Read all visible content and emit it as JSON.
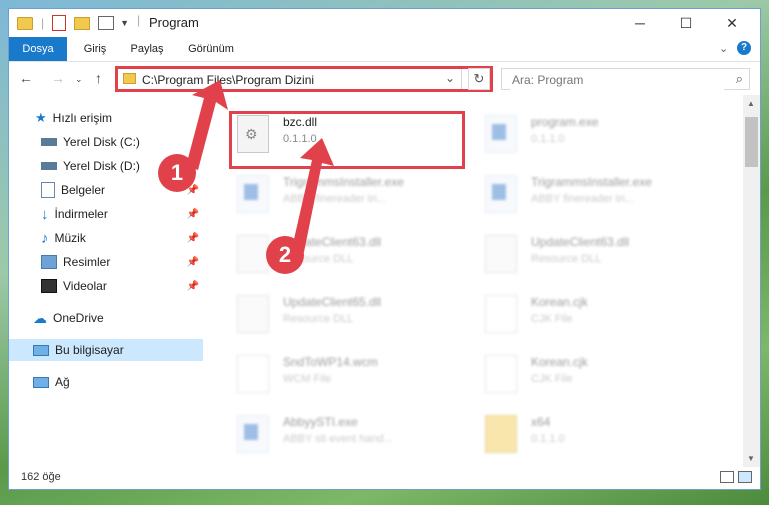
{
  "window": {
    "title": "Program",
    "controls": {
      "minimize": "─",
      "maximize": "☐",
      "close": "✕"
    }
  },
  "ribbon": {
    "tabs": [
      "Dosya",
      "Giriş",
      "Paylaş",
      "Görünüm"
    ],
    "file_tab_color": "#1979ca"
  },
  "navigation": {
    "address": "C:\\Program Files\\Program Dizini",
    "search_placeholder": "Ara: Program"
  },
  "sidebar": {
    "quick_access": "Hızlı erişim",
    "items": [
      {
        "label": "Yerel Disk (C:)",
        "icon": "drive-icon",
        "pinned": false
      },
      {
        "label": "Yerel Disk (D:)",
        "icon": "drive-icon",
        "pinned": false
      },
      {
        "label": "Belgeler",
        "icon": "documents-icon",
        "pinned": true
      },
      {
        "label": "İndirmeler",
        "icon": "download-icon",
        "pinned": true
      },
      {
        "label": "Müzik",
        "icon": "music-icon",
        "pinned": true
      },
      {
        "label": "Resimler",
        "icon": "pictures-icon",
        "pinned": true
      },
      {
        "label": "Videolar",
        "icon": "videos-icon",
        "pinned": true
      }
    ],
    "onedrive": "OneDrive",
    "this_pc": "Bu bilgisayar",
    "network": "Ağ"
  },
  "files": [
    {
      "name": "bzc.dll",
      "sub": "0.1.1.0",
      "type": "dll",
      "highlighted": true
    },
    {
      "name": "program.exe",
      "sub": "0.1.1.0",
      "type": "exe"
    },
    {
      "name": "TrigrammsInstaller.exe",
      "sub": "ABBY finereader tri...",
      "type": "exe"
    },
    {
      "name": "TrigrammsInstaller.exe",
      "sub": "ABBY finereader tri...",
      "type": "exe"
    },
    {
      "name": "UpdateClient63.dll",
      "sub": "Resource DLL",
      "type": "dll"
    },
    {
      "name": "UpdateClient63.dll",
      "sub": "Resource DLL",
      "type": "dll"
    },
    {
      "name": "UpdateClient65.dll",
      "sub": "Resource DLL",
      "type": "dll"
    },
    {
      "name": "Korean.cjk",
      "sub": "CJK File",
      "type": "page"
    },
    {
      "name": "SndToWP14.wcm",
      "sub": "WCM File",
      "type": "page"
    },
    {
      "name": "Korean.cjk",
      "sub": "CJK File",
      "type": "page"
    },
    {
      "name": "AbbyySTI.exe",
      "sub": "ABBY sti event hand...",
      "type": "exe"
    },
    {
      "name": "x64",
      "sub": "0.1.1.0",
      "type": "folder"
    }
  ],
  "status": {
    "count": "162 öğe"
  },
  "annotations": {
    "step1": "1",
    "step2": "2",
    "accent": "#e0414a"
  }
}
